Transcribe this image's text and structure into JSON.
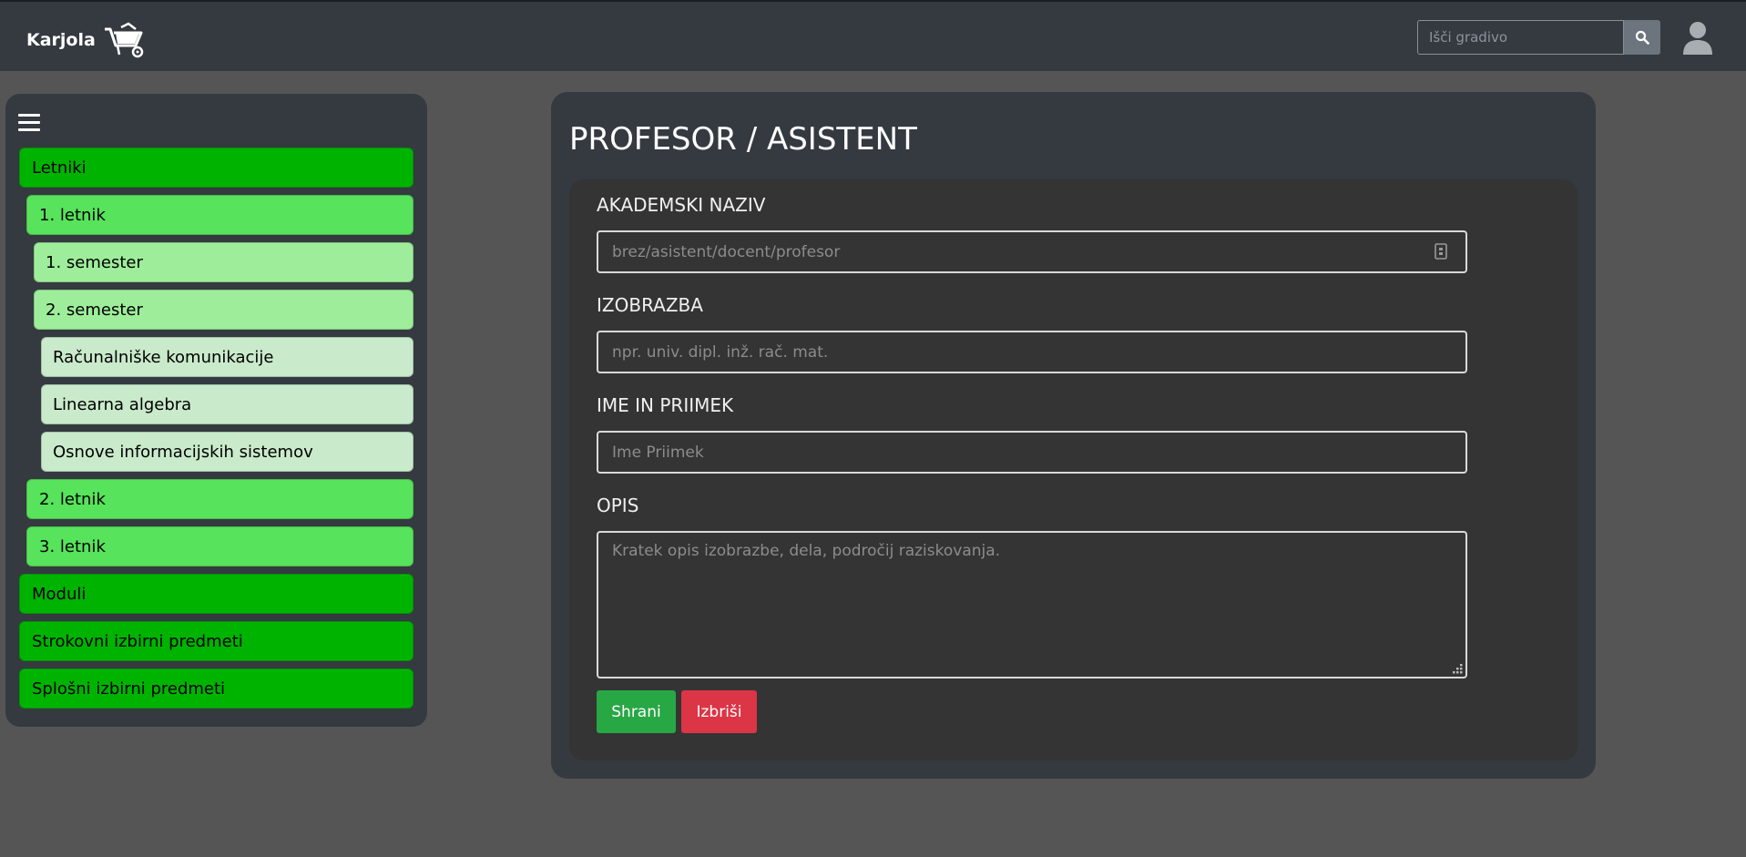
{
  "header": {
    "brand": "Karjola",
    "logo_icon": "wheelbarrow-icon",
    "search_placeholder": "Išči gradivo",
    "search_icon": "search-icon",
    "user_icon": "user-icon"
  },
  "sidebar": {
    "menu_icon": "hamburger-icon",
    "items": [
      {
        "label": "Letniki",
        "level": 0
      },
      {
        "label": "1. letnik",
        "level": 1
      },
      {
        "label": "1. semester",
        "level": 2
      },
      {
        "label": "2. semester",
        "level": 2
      },
      {
        "label": "Računalniške komunikacije",
        "level": 3
      },
      {
        "label": "Linearna algebra",
        "level": 3
      },
      {
        "label": "Osnove informacijskih sistemov",
        "level": 3
      },
      {
        "label": "2. letnik",
        "level": 1
      },
      {
        "label": "3. letnik",
        "level": 1
      },
      {
        "label": "Moduli",
        "level": 0
      },
      {
        "label": "Strokovni izbirni predmeti",
        "level": 0
      },
      {
        "label": "Splošni izbirni predmeti",
        "level": 0
      }
    ]
  },
  "main": {
    "title": "PROFESOR / ASISTENT",
    "form": {
      "academic_title": {
        "label": "AKADEMSKI NAZIV",
        "placeholder": "brez/asistent/docent/profesor",
        "value": ""
      },
      "education": {
        "label": "IZOBRAZBA",
        "placeholder": "npr. univ. dipl. inž. rač. mat.",
        "value": ""
      },
      "full_name": {
        "label": "IME IN PRIIMEK",
        "placeholder": "Ime Priimek",
        "value": ""
      },
      "description": {
        "label": "OPIS",
        "placeholder": "Kratek opis izobrazbe, dela, področij raziskovanja.",
        "value": ""
      },
      "save_label": "Shrani",
      "delete_label": "Izbriši"
    }
  },
  "colors": {
    "navbar": "#343a40",
    "background": "#555555",
    "level0": "#00b300",
    "level1": "#57e35b",
    "level2": "#9eed9a",
    "level3": "#c9eacb",
    "save": "#28a745",
    "delete": "#dc3545"
  }
}
